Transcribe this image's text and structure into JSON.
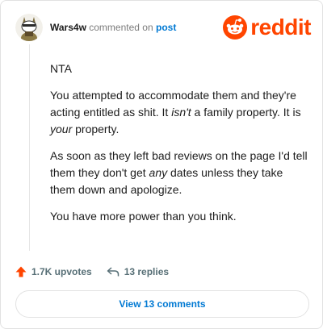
{
  "header": {
    "username": "Wars4w",
    "action_text": "commented on",
    "target_link": "post",
    "brand": "reddit"
  },
  "comment": {
    "paragraphs": [
      {
        "parts": [
          {
            "text": "NTA",
            "italic": false
          }
        ]
      },
      {
        "parts": [
          {
            "text": "You attempted to accommodate them and they're acting entitled as shit. It ",
            "italic": false
          },
          {
            "text": "isn't",
            "italic": true
          },
          {
            "text": " a family property. It is ",
            "italic": false
          },
          {
            "text": "your",
            "italic": true
          },
          {
            "text": " property.",
            "italic": false
          }
        ]
      },
      {
        "parts": [
          {
            "text": "As soon as they left bad reviews on the page I'd tell them they don't get ",
            "italic": false
          },
          {
            "text": "any",
            "italic": true
          },
          {
            "text": " dates unless they take them down and apologize.",
            "italic": false
          }
        ]
      },
      {
        "parts": [
          {
            "text": "You have more power than you think.",
            "italic": false
          }
        ]
      }
    ]
  },
  "actions": {
    "upvotes_label": "1.7K upvotes",
    "replies_label": "13 replies"
  },
  "view_comments_label": "View 13 comments",
  "icons": {
    "upvote": "upvote-arrow-icon",
    "reply": "reply-arrow-icon",
    "brand": "reddit-snoo-icon"
  },
  "colors": {
    "brand": "#ff4500",
    "link": "#0079d3",
    "muted": "#576f76"
  }
}
